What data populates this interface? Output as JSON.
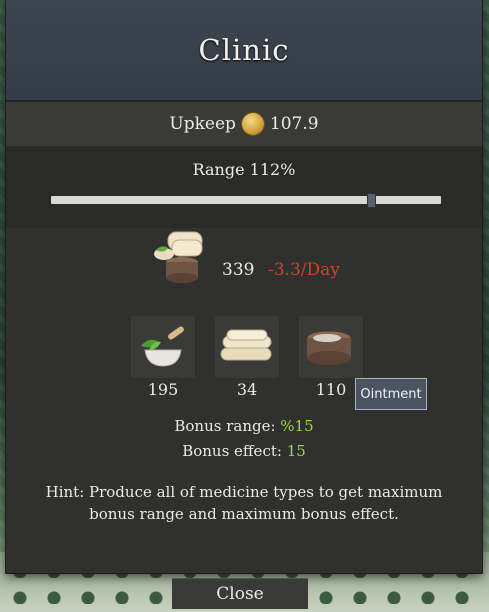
{
  "window": {
    "title": "Clinic"
  },
  "upkeep": {
    "label": "Upkeep",
    "value": "107.9",
    "icon": "gold-coin-icon"
  },
  "range": {
    "label": "Range",
    "value": "112%",
    "slider_level": 0.82
  },
  "main_resource": {
    "icon": "medicine-bundle-icon",
    "quantity": "339",
    "rate": "-3.3/Day"
  },
  "medicines": [
    {
      "icon": "herbs-mortar-icon",
      "count": "195"
    },
    {
      "icon": "bandage-rolls-icon",
      "count": "34"
    },
    {
      "icon": "ointment-jar-icon",
      "count": "110"
    }
  ],
  "tooltip": {
    "text": "Ointment"
  },
  "bonus": {
    "range_label": "Bonus range:",
    "range_value": "%15",
    "effect_label": "Bonus effect:",
    "effect_value": "15"
  },
  "hint": {
    "line1": "Hint: Produce all of medicine types to get maximum",
    "line2": "bonus range and maximum bonus effect."
  },
  "close_label": "Close",
  "colors": {
    "negative_rate": "#d6402c",
    "bonus_green": "#9fd63a",
    "title_bar": "#3d4650"
  }
}
